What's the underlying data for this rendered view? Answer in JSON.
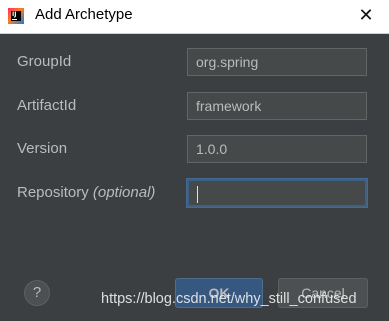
{
  "window": {
    "title": "Add Archetype",
    "close_glyph": "✕",
    "app_icon_letters": "IJ"
  },
  "form": {
    "group_id": {
      "label": "GroupId",
      "value": "org.spring"
    },
    "artifact_id": {
      "label": "ArtifactId",
      "value": "framework"
    },
    "version": {
      "label": "Version",
      "value": "1.0.0"
    },
    "repository": {
      "label": "Repository ",
      "label_hint": "(optional)",
      "value": ""
    }
  },
  "buttons": {
    "help": "?",
    "ok": "OK",
    "cancel": "Cancel"
  },
  "watermark": "https://blog.csdn.net/why_still_confused",
  "colors": {
    "dialog_bg": "#3c3f41",
    "field_bg": "#45494a",
    "text": "#bbbbbb",
    "focus_border": "#3d6185",
    "ok_button_bg": "#365880"
  }
}
